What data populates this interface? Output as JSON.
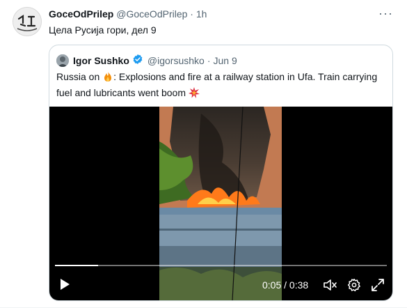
{
  "tweet": {
    "display_name": "GoceOdPrilep",
    "handle": "@GoceOdPrilep",
    "separator": "·",
    "time": "1h",
    "text": "Цела Русија гори, дел 9",
    "more_label": "···"
  },
  "quote": {
    "display_name": "Igor Sushko",
    "handle": "@igorsushko",
    "separator": "·",
    "date": "Jun 9",
    "text_part1": "Russia on ",
    "emoji_fire": "fire-emoji",
    "text_part2": ": Explosions and fire at a railway station in Ufa. Train carrying fuel and lubricants went boom ",
    "emoji_boom": "collision-emoji"
  },
  "video": {
    "current_time": "0:05",
    "time_separator": " / ",
    "duration": "0:38",
    "progress": 0.13
  },
  "colors": {
    "accent_verified": "#1d9bf0",
    "text_primary": "#0f1419",
    "text_muted": "#536471"
  },
  "icons": [
    "play-icon",
    "volume-icon",
    "settings-gear-icon",
    "fullscreen-icon",
    "verified-badge-icon",
    "more-options-icon"
  ]
}
